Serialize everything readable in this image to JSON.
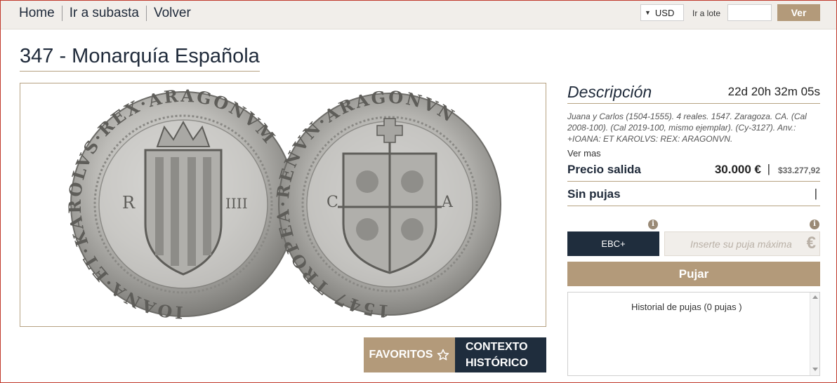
{
  "nav": {
    "home": "Home",
    "ir_subasta": "Ir a subasta",
    "volver": "Volver",
    "currency": "USD",
    "ir_lote_label": "Ir a lote",
    "ir_lote_value": "",
    "ver_label": "Ver"
  },
  "lot": {
    "title": "347 - Monarquía Española",
    "coin_legend_left": "IOANA·ET·KAROLVS·REX·ARAGONVM",
    "coin_legend_right": "1547 TROPEA·RENVN·ARAGONVN",
    "coin_marks": {
      "left": "R",
      "right": "IIII",
      "c": "C",
      "a": "A"
    }
  },
  "actions": {
    "favoritos": "FAVORITOS",
    "contexto_line1": "CONTEXTO",
    "contexto_line2": "HISTÓRICO"
  },
  "description": {
    "heading": "Descripción",
    "countdown": "22d 20h 32m 05s",
    "text": "Juana y Carlos (1504-1555). 4 reales. 1547. Zaragoza. CA. (Cal 2008-100). (Cal 2019-100, mismo ejemplar). (Cy-3127). Anv.: +IOANA: ET KAROLVS: REX: ARAGONVN.",
    "ver_mas": "Ver mas",
    "precio_label": "Precio salida",
    "precio_eur": "30.000 €",
    "precio_sep": "|",
    "precio_usd": "$33.277,92",
    "sin_pujas": "Sin pujas",
    "sin_pujas_bar": "|"
  },
  "bid": {
    "grade": "EBC+",
    "placeholder": "Inserte su puja máxima",
    "currency_symbol": "€",
    "pujar": "Pujar",
    "info_glyph": "i",
    "historial": "Historial de pujas (0 pujas )"
  },
  "colors": {
    "accent": "#b39a7a",
    "dark": "#1f2d3d",
    "topbar": "#f1eeea"
  }
}
